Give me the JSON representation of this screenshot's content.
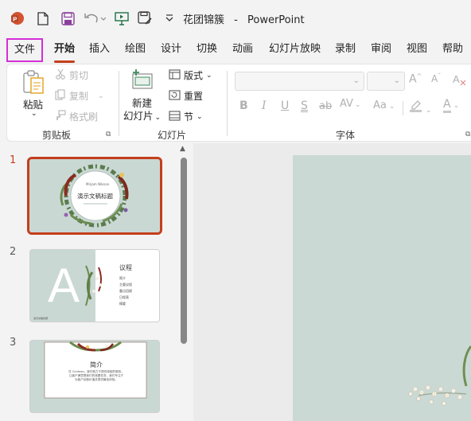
{
  "app": {
    "doc_name": "花团锦簇",
    "separator": "-",
    "app_name": "PowerPoint"
  },
  "quick_access": {
    "icons": [
      "powerpoint-logo-icon",
      "new-file-icon",
      "save-icon",
      "undo-icon",
      "present-from-start-icon",
      "save-as-icon",
      "customize-dropdown-icon"
    ]
  },
  "menu": {
    "tabs": [
      "文件",
      "开始",
      "插入",
      "绘图",
      "设计",
      "切换",
      "动画",
      "幻灯片放映",
      "录制",
      "审阅",
      "视图",
      "帮助"
    ],
    "active": "开始",
    "highlighted": "文件"
  },
  "ribbon": {
    "clipboard": {
      "paste": "粘贴",
      "cut": "剪切",
      "copy": "复制",
      "format_painter": "格式刷",
      "group_label": "剪贴板"
    },
    "slides": {
      "new_slide_line1": "新建",
      "new_slide_line2": "幻灯片",
      "layout": "版式",
      "reset": "重置",
      "section": "节",
      "group_label": "幻灯片"
    },
    "font": {
      "group_label": "字体",
      "buttons": [
        "B",
        "I",
        "U",
        "S",
        "ab",
        "AV",
        "Aa",
        "A",
        "A"
      ]
    }
  },
  "thumbnails": [
    {
      "number": "1",
      "selected": true,
      "subtitle": "Mirjam Nilsson",
      "title": "演示文稿标题"
    },
    {
      "number": "2",
      "selected": false,
      "letter": "A",
      "title": "议程",
      "items": [
        "简介",
        "主要议程",
        "重点回顾",
        "日程表",
        "摘要"
      ],
      "footer": "演示文稿标题"
    },
    {
      "number": "3",
      "selected": false,
      "title": "简介",
      "body": "在 Contoso，我们致力于提供卓越的服务。让客户满意是我们的首要任务，我们专注于为客户创造价值并提供最佳体验。"
    }
  ],
  "colors": {
    "accent": "#c43e1c",
    "file_tab_border": "#d42fd7",
    "slide_bg": "#c9d8d3"
  }
}
